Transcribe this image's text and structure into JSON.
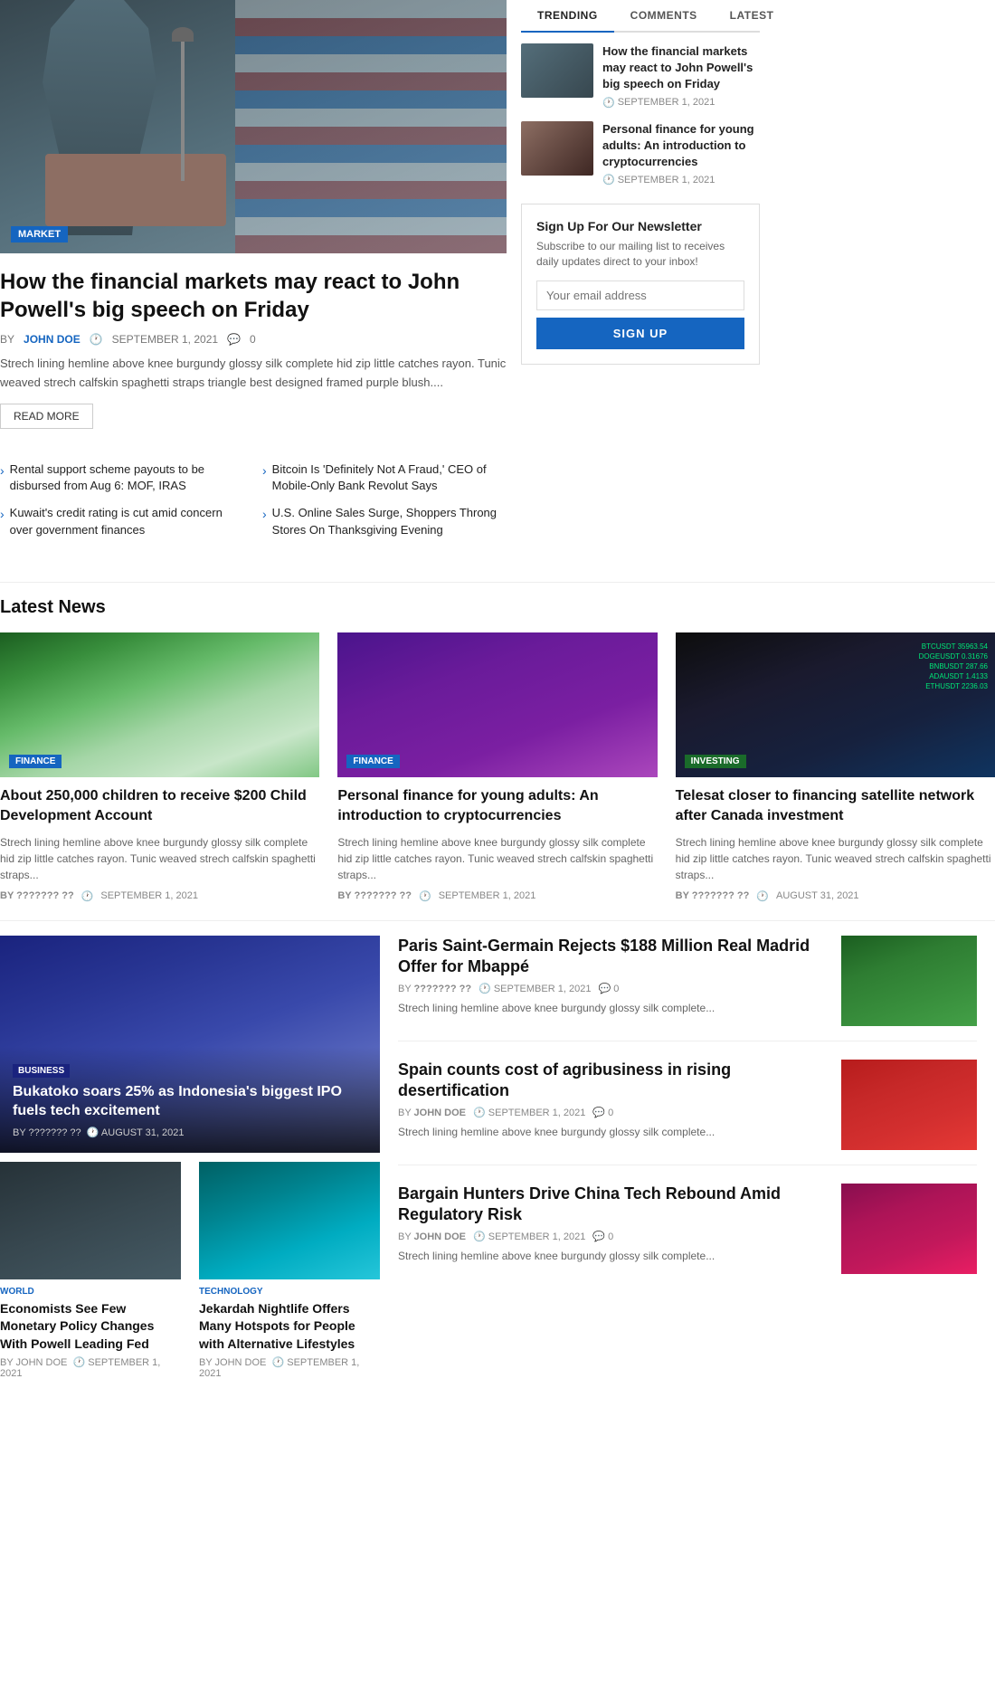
{
  "tabs": {
    "items": [
      {
        "label": "TRENDING",
        "active": true
      },
      {
        "label": "COMMENTS",
        "active": false
      },
      {
        "label": "LATEST",
        "active": false
      }
    ]
  },
  "sidebar": {
    "item1": {
      "title": "How the financial markets may react to John Powell's big speech on Friday",
      "date": "SEPTEMBER 1, 2021"
    },
    "item2": {
      "title": "Personal finance for young adults: An introduction to cryptocurrencies",
      "date": "SEPTEMBER 1, 2021"
    }
  },
  "hero": {
    "category": "MARKET",
    "title": "How the financial markets may react to John Powell's big speech on Friday",
    "author": "JOHN DOE",
    "date": "SEPTEMBER 1, 2021",
    "comments": "0",
    "excerpt": "Strech lining hemline above knee burgundy glossy silk complete hid zip little catches rayon. Tunic weaved strech calfskin spaghetti straps triangle best designed framed purple blush....",
    "read_more": "READ MORE"
  },
  "bullets": {
    "col1": [
      {
        "text": "Rental support scheme payouts to be disbursed from Aug 6: MOF, IRAS"
      },
      {
        "text": "Kuwait's credit rating is cut amid concern over government finances"
      }
    ],
    "col2": [
      {
        "text": "Bitcoin Is 'Definitely Not A Fraud,' CEO of Mobile-Only Bank Revolut Says"
      },
      {
        "text": "U.S. Online Sales Surge, Shoppers Throng Stores On Thanksgiving Evening"
      }
    ]
  },
  "newsletter": {
    "title": "Sign Up For Our Newsletter",
    "desc": "Subscribe to our mailing list to receives daily updates direct to your inbox!",
    "placeholder": "Your email address",
    "button_label": "SIGN UP"
  },
  "latest_news": {
    "section_title": "Latest News",
    "cards": [
      {
        "category": "FINANCE",
        "title": "About 250,000 children to receive $200 Child Development Account",
        "excerpt": "Strech lining hemline above knee burgundy glossy silk complete hid zip little catches rayon. Tunic weaved strech calfskin spaghetti straps...",
        "author": "??????? ??",
        "date": "SEPTEMBER 1, 2021"
      },
      {
        "category": "FINANCE",
        "title": "Personal finance for young adults: An introduction to cryptocurrencies",
        "excerpt": "Strech lining hemline above knee burgundy glossy silk complete hid zip little catches rayon. Tunic weaved strech calfskin spaghetti straps...",
        "author": "??????? ??",
        "date": "SEPTEMBER 1, 2021"
      },
      {
        "category": "INVESTING",
        "title": "Telesat closer to financing satellite network after Canada investment",
        "excerpt": "Strech lining hemline above knee burgundy glossy silk complete hid zip little catches rayon. Tunic weaved strech calfskin spaghetti straps...",
        "author": "??????? ??",
        "date": "AUGUST 31, 2021"
      }
    ]
  },
  "featured_article": {
    "category": "BUSINESS",
    "title": "Bukatoko soars 25% as Indonesia's biggest IPO fuels tech excitement",
    "author": "??????? ??",
    "date": "AUGUST 31, 2021"
  },
  "bottom_small": [
    {
      "category": "WORLD",
      "title": "Economists See Few Monetary Policy Changes With Powell Leading Fed",
      "author": "JOHN DOE",
      "date": "SEPTEMBER 1, 2021"
    },
    {
      "category": "TECHNOLOGY",
      "title": "Jekardah Nightlife Offers Many Hotspots for People with Alternative Lifestyles",
      "author": "JOHN DOE",
      "date": "SEPTEMBER 1, 2021"
    }
  ],
  "center_articles": [
    {
      "title": "Paris Saint-Germain Rejects $188 Million Real Madrid Offer for Mbappé",
      "author": "??????? ??",
      "date": "SEPTEMBER 1, 2021",
      "comments": "0",
      "excerpt": "Strech lining hemline above knee burgundy glossy silk complete..."
    },
    {
      "title": "Spain counts cost of agribusiness in rising desertification",
      "author": "JOHN DOE",
      "date": "SEPTEMBER 1, 2021",
      "comments": "0",
      "excerpt": "Strech lining hemline above knee burgundy glossy silk complete..."
    },
    {
      "title": "Bargain Hunters Drive China Tech Rebound Amid Regulatory Risk",
      "author": "JOHN DOE",
      "date": "SEPTEMBER 1, 2021",
      "comments": "0",
      "excerpt": "Strech lining hemline above knee burgundy glossy silk complete..."
    }
  ],
  "colors": {
    "accent": "#1565c0",
    "text_primary": "#111111",
    "text_secondary": "#666666",
    "border": "#dddddd"
  }
}
